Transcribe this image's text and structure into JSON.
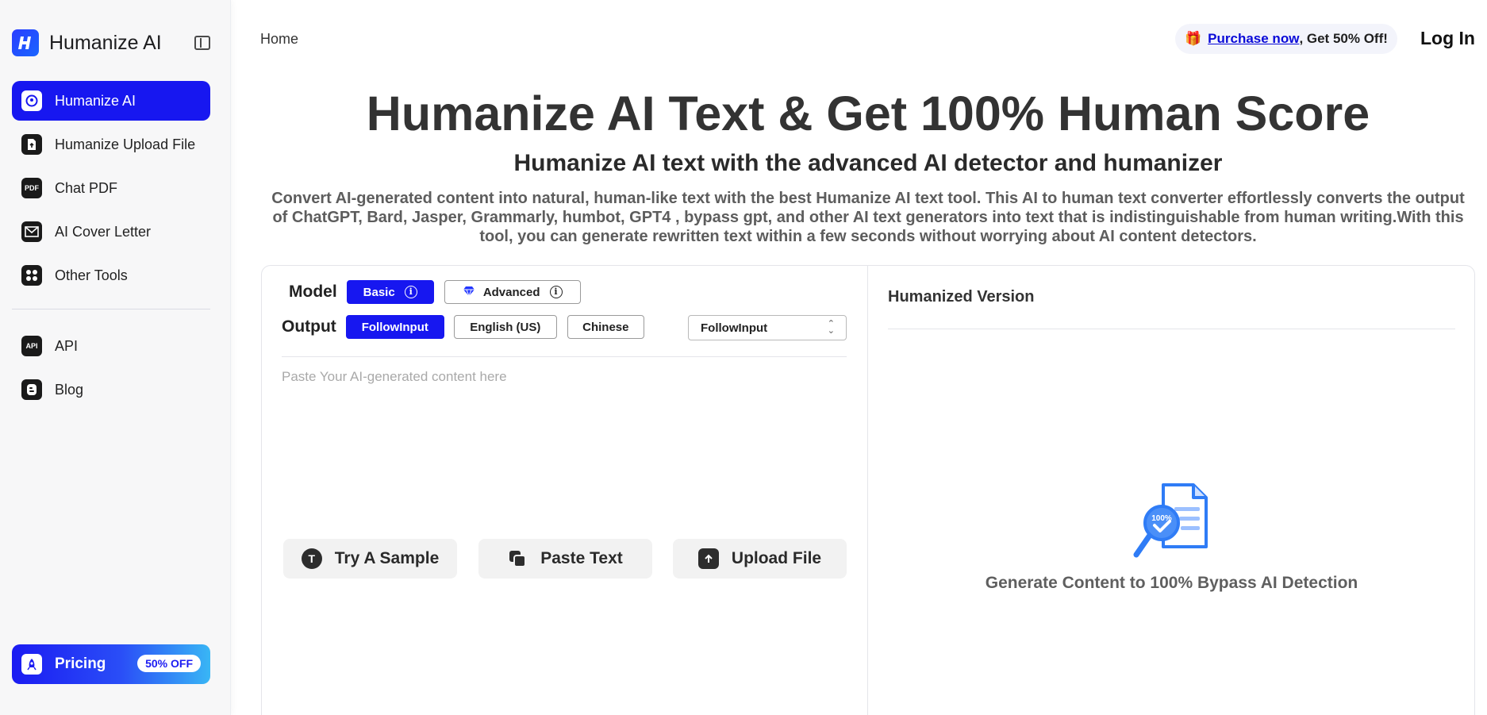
{
  "sidebar": {
    "brand": "Humanize AI",
    "items": [
      {
        "label": "Humanize AI",
        "icon": "brain-icon",
        "active": true
      },
      {
        "label": "Humanize Upload File",
        "icon": "file-upload-icon",
        "active": false
      },
      {
        "label": "Chat PDF",
        "icon": "pdf-icon",
        "active": false
      },
      {
        "label": "AI Cover Letter",
        "icon": "envelope-icon",
        "active": false
      },
      {
        "label": "Other Tools",
        "icon": "grid-icon",
        "active": false
      }
    ],
    "secondary_items": [
      {
        "label": "API",
        "icon": "api-icon"
      },
      {
        "label": "Blog",
        "icon": "blogger-icon"
      }
    ],
    "pricing": {
      "label": "Pricing",
      "badge": "50% OFF"
    }
  },
  "header": {
    "breadcrumb": "Home",
    "promo_link": "Purchase now",
    "promo_rest": ", Get 50% Off!",
    "login": "Log In"
  },
  "hero": {
    "title": "Humanize AI Text & Get 100% Human Score",
    "subtitle": "Humanize AI text with the advanced AI detector and humanizer",
    "description": "Convert AI-generated content into natural, human-like text with the best Humanize AI text tool. This AI to human text converter effortlessly converts the output of ChatGPT, Bard, Jasper, Grammarly, humbot, GPT4 , bypass gpt, and other AI text generators into text that is indistinguishable from human writing.With this tool, you can generate rewritten text within a few seconds without worrying about AI content detectors."
  },
  "tool": {
    "model_label": "Model",
    "models": [
      {
        "label": "Basic",
        "active": true
      },
      {
        "label": "Advanced",
        "active": false
      }
    ],
    "output_label": "Output",
    "outputs": [
      {
        "label": "FollowInput",
        "active": true
      },
      {
        "label": "English (US)",
        "active": false
      },
      {
        "label": "Chinese",
        "active": false
      }
    ],
    "output_select": "FollowInput",
    "input_placeholder": "Paste Your AI-generated content here",
    "actions": [
      {
        "label": "Try A Sample",
        "icon": "sample-text-icon"
      },
      {
        "label": "Paste Text",
        "icon": "copy-icon"
      },
      {
        "label": "Upload File",
        "icon": "upload-icon"
      }
    ],
    "result_title": "Humanized Version",
    "result_empty_badge": "100%",
    "result_empty_text": "Generate Content to 100% Bypass AI Detection"
  },
  "colors": {
    "accent": "#1717f0",
    "link": "#0a0ad8",
    "illustration": "#2f7cf6"
  }
}
